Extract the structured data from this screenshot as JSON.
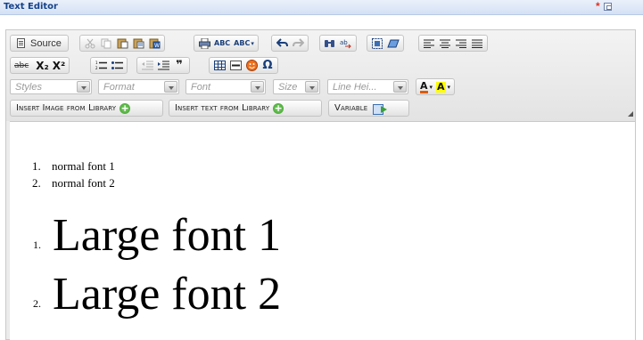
{
  "window": {
    "title": "Text Editor",
    "modified_marker": "*"
  },
  "toolbar": {
    "row1": {
      "source_label": "Source",
      "abc_label": "ABC",
      "abc2_label": "ABC"
    },
    "row2": {
      "strike_label": "abc",
      "subscript_label": "X₂",
      "superscript_label": "X²",
      "blockquote_label": "❞",
      "omega_label": "Ω"
    },
    "row3": {
      "styles_placeholder": "Styles",
      "format_placeholder": "Format",
      "font_placeholder": "Font",
      "size_placeholder": "Size",
      "line_height_placeholder": "Line Hei...",
      "text_color_label": "A",
      "bg_color_label": "A"
    },
    "row4": {
      "insert_image_label": "Insert Image from Library",
      "insert_text_label": "Insert text from Library",
      "variable_label": "Variable"
    }
  },
  "content": {
    "small_list": [
      {
        "num": "1.",
        "text": "normal font 1"
      },
      {
        "num": "2.",
        "text": "normal font 2"
      }
    ],
    "large_list": [
      {
        "num": "1.",
        "text": "Large font 1"
      },
      {
        "num": "2.",
        "text": "Large font 2"
      }
    ]
  },
  "colors": {
    "title_text": "#15428b",
    "text_color_swatch": "#e05a00",
    "bg_color_swatch": "#ffff00",
    "plus_icon": "#3d9a2c"
  }
}
